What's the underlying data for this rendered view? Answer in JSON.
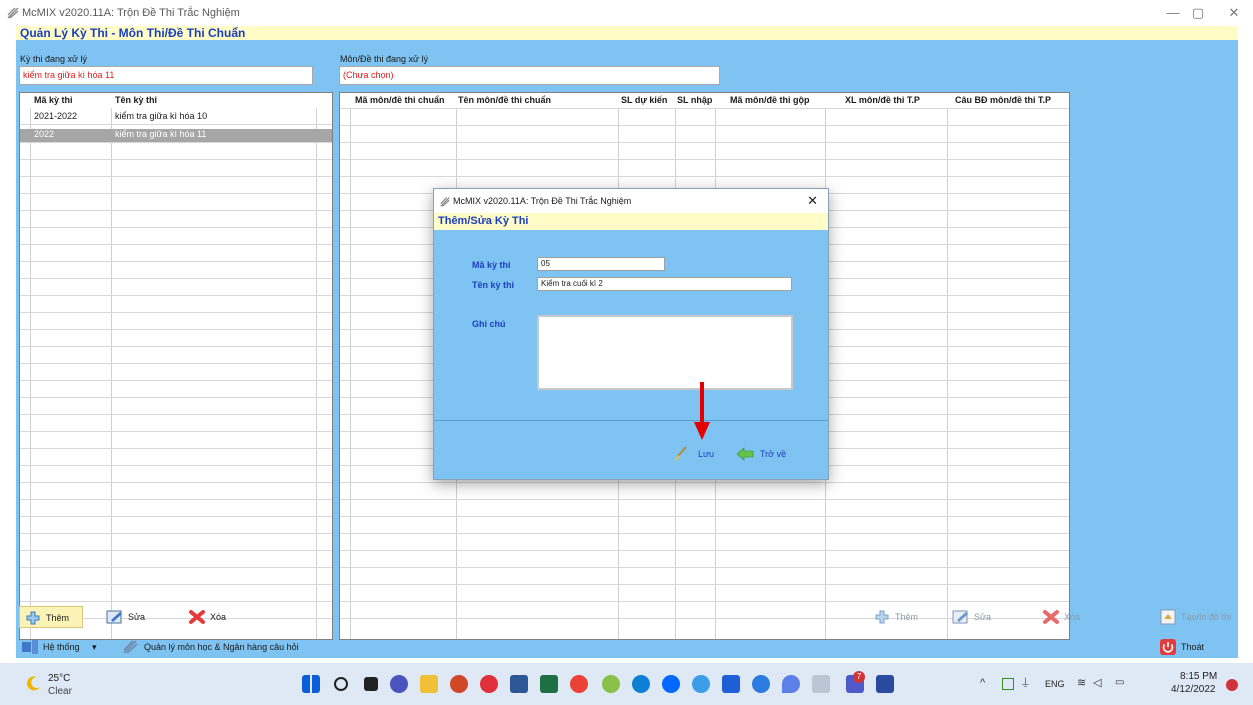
{
  "window": {
    "title": "McMIX v2020.11A: Trộn Đề Thi Trắc Nghiệm",
    "section_title": "Quản Lý Kỳ Thi - Môn Thi/Đề Thi Chuẩn"
  },
  "left_panel": {
    "label": "Kỳ thi đang xử lý",
    "value": "kiểm tra giữa kì hóa 11",
    "columns": [
      "Mã kỳ thi",
      "Tên kỳ thi"
    ],
    "rows": [
      {
        "code": "2021-2022",
        "name": "kiểm tra giữa kì hóa 10"
      },
      {
        "code": "2022",
        "name": "kiểm tra giữa kì hóa 11"
      }
    ]
  },
  "right_panel": {
    "label": "Môn/Đề thi đang xử lý",
    "value": "(Chưa chọn)",
    "columns": [
      "Mã môn/đề thi chuẩn",
      "Tên môn/đề thi chuẩn",
      "SL dự kiến",
      "SL nhập",
      "Mã môn/đề thi gộp",
      "XL môn/đề thi T.P",
      "Câu BĐ môn/đề thi T.P"
    ]
  },
  "toolbar_left": {
    "add": "Thêm",
    "edit": "Sửa",
    "delete": "Xóa"
  },
  "toolbar_right": {
    "add": "Thêm",
    "edit": "Sửa",
    "delete": "Xóa",
    "create_print": "Tạo/In đề thi"
  },
  "bottom_bar": {
    "system": "Hệ thống",
    "manage": "Quản lý môn học & Ngân hàng câu hỏi",
    "exit": "Thoát"
  },
  "dialog": {
    "title": "McMIX v2020.11A: Trộn Đề Thi Trắc Nghiệm",
    "subtitle": "Thêm/Sửa Kỳ Thi",
    "code_label": "Mã kỳ thi",
    "code_value": "05",
    "name_label": "Tên kỳ thi",
    "name_value": "Kiểm tra cuối kì 2",
    "note_label": "Ghi chú",
    "note_value": "",
    "save_label": "Lưu",
    "back_label": "Trở về"
  },
  "taskbar": {
    "temperature": "25°C",
    "weather": "Clear",
    "language": "ENG",
    "time": "8:15 PM",
    "date": "4/12/2022",
    "notification_count": "7"
  },
  "colors": {
    "panel_bg": "#7ec3f1",
    "section_title": "#1a3fc0",
    "value_red": "#e02020",
    "yellow_bar": "#fffcc7"
  }
}
